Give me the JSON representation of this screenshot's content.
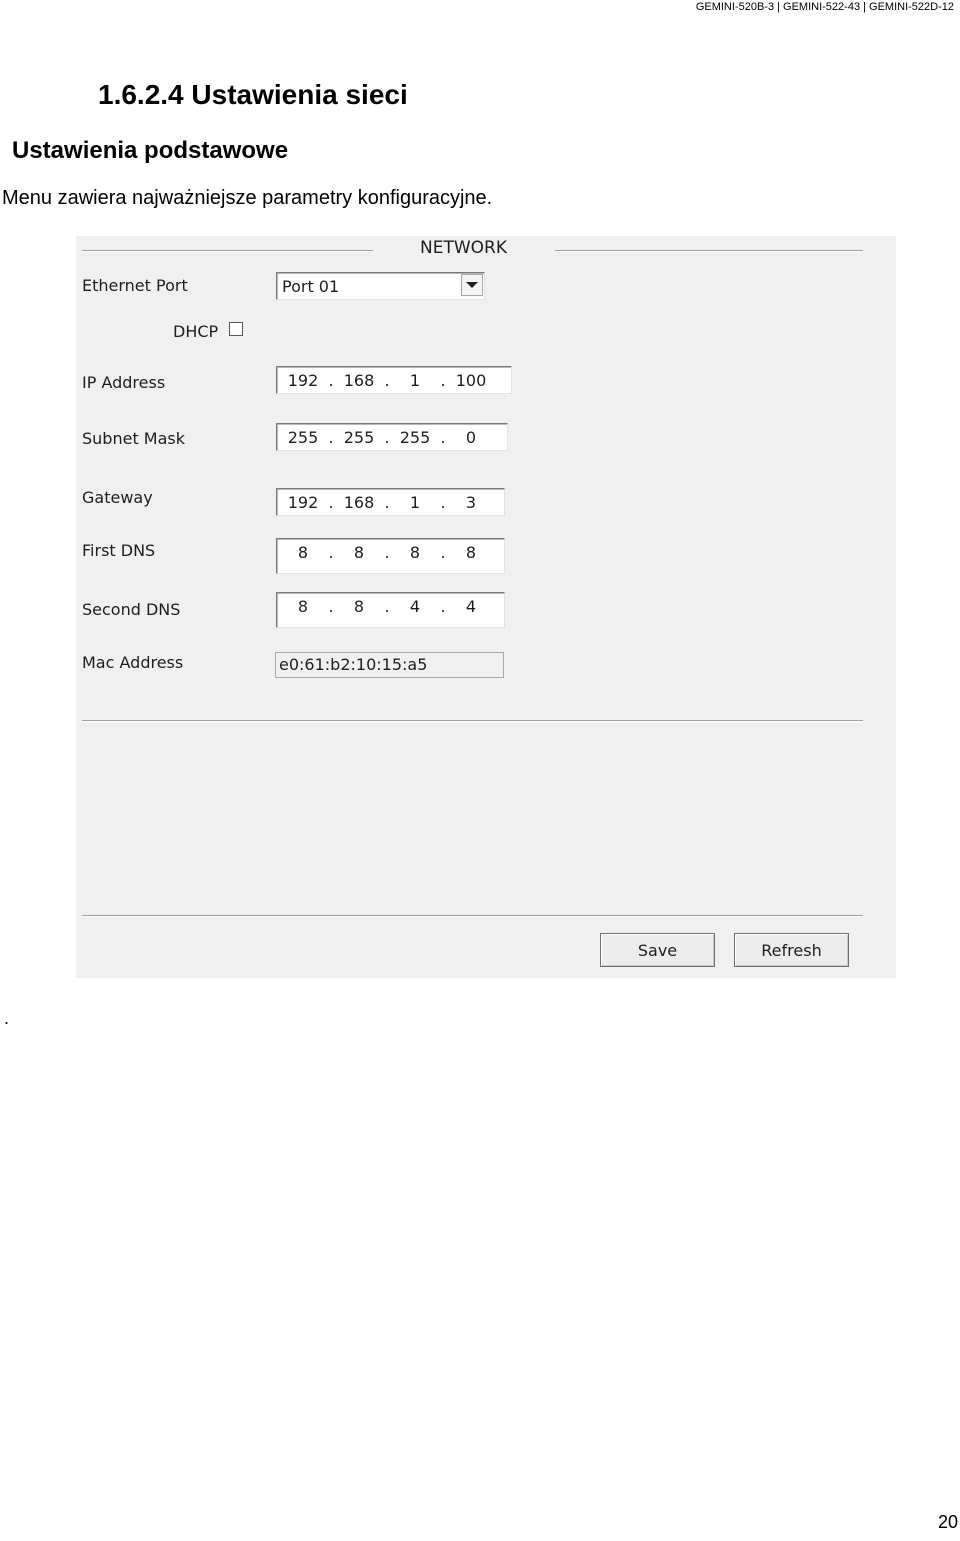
{
  "header": {
    "models": "GEMINI-520B-3 | GEMINI-522-43 | GEMINI-522D-12"
  },
  "document": {
    "section_title": "1.6.2.4 Ustawienia sieci",
    "subsection_title": "Ustawienia podstawowe",
    "intro": "Menu zawiera najważniejsze parametry konfiguracyjne.",
    "trailing_dot": ".",
    "page_number": "20"
  },
  "network": {
    "title": "NETWORK",
    "ethernet_port": {
      "label": "Ethernet Port",
      "value": "Port 01"
    },
    "dhcp": {
      "label": "DHCP",
      "checked": false
    },
    "ip_address": {
      "label": "IP Address",
      "octets": [
        "192",
        "168",
        "1",
        "100"
      ]
    },
    "subnet_mask": {
      "label": "Subnet Mask",
      "octets": [
        "255",
        "255",
        "255",
        "0"
      ]
    },
    "gateway": {
      "label": "Gateway",
      "octets": [
        "192",
        "168",
        "1",
        "3"
      ]
    },
    "first_dns": {
      "label": "First DNS",
      "octets": [
        "8",
        "8",
        "8",
        "8"
      ]
    },
    "second_dns": {
      "label": "Second DNS",
      "octets": [
        "8",
        "8",
        "4",
        "4"
      ]
    },
    "mac_address": {
      "label": "Mac Address",
      "value": "e0:61:b2:10:15:a5"
    },
    "ip_separator": ".",
    "buttons": {
      "save": "Save",
      "refresh": "Refresh"
    }
  }
}
